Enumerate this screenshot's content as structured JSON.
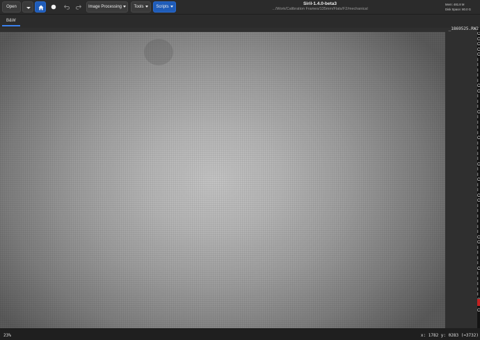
{
  "header": {
    "open_label": "Open",
    "image_processing_label": "Image Processing",
    "tools_label": "Tools",
    "scripts_label": "Scripts",
    "title": "Siril-1.4.0-beta3",
    "path": ".../Work/Calibration Frames/135mm/Flats/F2/mechanical",
    "mem": "Mem: 481.8 M",
    "disk": "Disk Space: 80.0 G"
  },
  "tabs": [
    {
      "label": "B&W"
    }
  ],
  "viewer": {
    "filename": "_1869525.RW2",
    "zoom": "23%",
    "coords": "x: 1782 y: 0283 (=3732)"
  },
  "log_lines": [
    "C",
    "C",
    "C",
    "C",
    "C",
    "I",
    "I",
    "I",
    "I",
    "I",
    "C",
    "C",
    "I",
    "I",
    "I",
    "C",
    "I",
    "I",
    "I",
    "I",
    "C",
    "I",
    "I",
    "I",
    "I",
    "C",
    "I",
    "I",
    "C",
    "I",
    "I",
    "C",
    "C",
    "I",
    "I",
    "I",
    "I",
    "I",
    "I",
    "C",
    "C",
    "I",
    "I",
    "I",
    "I",
    "C",
    "I",
    "I",
    "I",
    "I",
    "I",
    "C",
    "I",
    "C"
  ],
  "colors": {
    "accent": "#1f5cb8",
    "tab_underline": "#3b82f0"
  },
  "icons": [
    "open-dropdown-chevron",
    "home-icon",
    "record-icon",
    "undo-icon",
    "redo-icon"
  ]
}
